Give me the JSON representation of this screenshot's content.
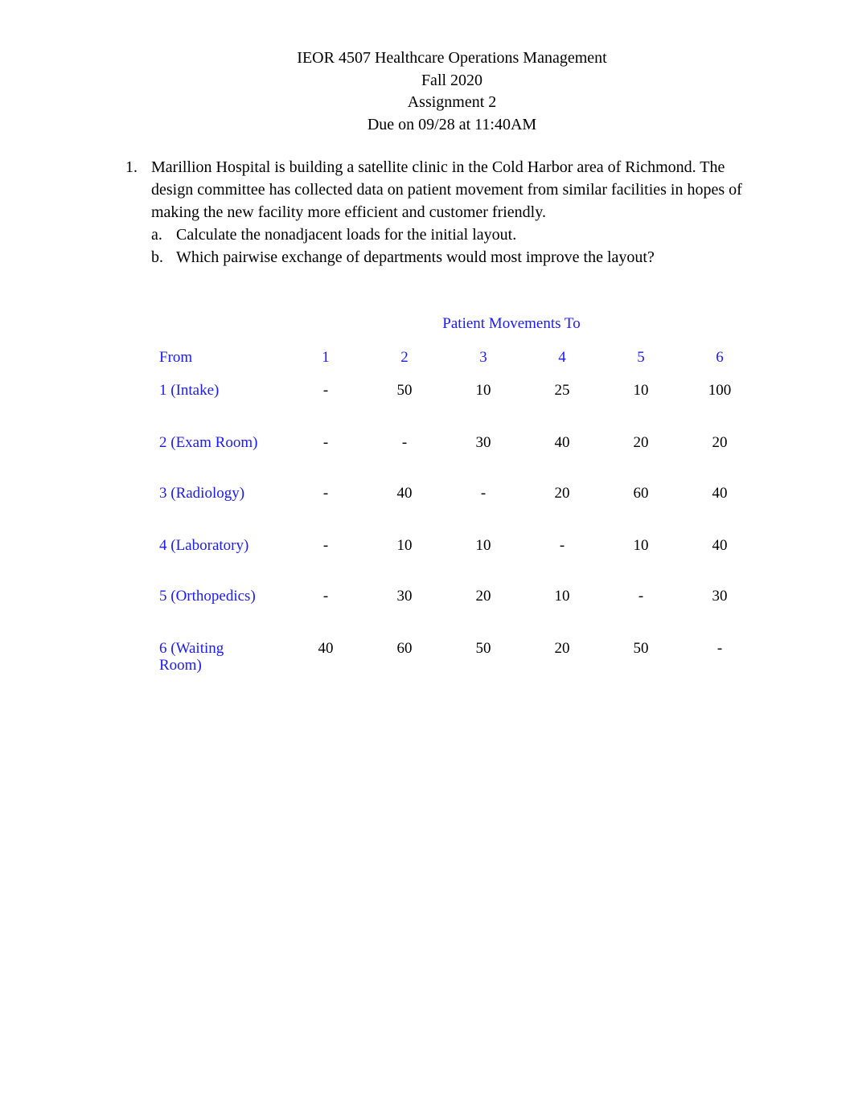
{
  "header": {
    "course": "IEOR 4507 Healthcare Operations Management",
    "term": "Fall 2020",
    "assignment": "Assignment 2",
    "due": "Due on 09/28 at 11:40AM"
  },
  "question": {
    "number": "1.",
    "text": "Marillion Hospital is building a satellite clinic in the Cold Harbor area of Richmond. The design committee has collected data on patient movement from similar facilities in hopes of making the new facility more efficient and customer friendly.",
    "parts": [
      {
        "label": "a.",
        "text": "Calculate the nonadjacent loads for the initial layout."
      },
      {
        "label": "b.",
        "text": "Which pairwise exchange of departments would most improve the layout?"
      }
    ]
  },
  "table": {
    "title": "Patient Movements To",
    "from_label": "From",
    "columns": [
      "1",
      "2",
      "3",
      "4",
      "5",
      "6"
    ],
    "rows": [
      {
        "label": "1 (Intake)",
        "values": [
          "-",
          "50",
          "10",
          "25",
          "10",
          "100"
        ]
      },
      {
        "label": "2 (Exam Room)",
        "values": [
          "-",
          "-",
          "30",
          "40",
          "20",
          "20"
        ]
      },
      {
        "label": "3 (Radiology)",
        "values": [
          "-",
          "40",
          "-",
          "20",
          "60",
          "40"
        ]
      },
      {
        "label": "4 (Laboratory)",
        "values": [
          "-",
          "10",
          "10",
          "-",
          "10",
          "40"
        ]
      },
      {
        "label": "5 (Orthopedics)",
        "values": [
          "-",
          "30",
          "20",
          "10",
          "-",
          "30"
        ]
      },
      {
        "label": "6 (Waiting Room)",
        "label_lines": [
          "6 (Waiting",
          "Room)"
        ],
        "values": [
          "40",
          "60",
          "50",
          "20",
          "50",
          "-"
        ]
      }
    ]
  }
}
